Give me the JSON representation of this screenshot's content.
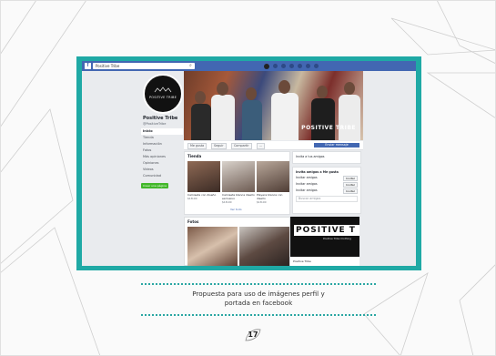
{
  "caption": {
    "line1": "Propuesta para uso de imágenes perfil y",
    "line2": "portada en facebook"
  },
  "page_number": "17",
  "facebook": {
    "logo": "f",
    "search_text": "Positive Tribe",
    "page_name": "Positive Tribe",
    "page_handle": "@PositiveTribe",
    "profile_logo_text": "POSITIVE TRIBE",
    "cover_caption": "POSITIVE TRIBE",
    "side_menu": [
      "Inicio",
      "Tienda",
      "Información",
      "Fotos",
      "Más opiniones",
      "Opiniones",
      "Videos",
      "Comunidad"
    ],
    "side_button": "Crear una página",
    "actions": [
      "Me gusta",
      "Seguir",
      "Compartir",
      "..."
    ],
    "send_button": "Enviar mensaje",
    "shop_title": "Tienda",
    "products": [
      {
        "caption": "Camiseta con diseño",
        "price": "$18.00"
      },
      {
        "caption": "Camiseta blanca diseño exclusivo",
        "price": "$18.00"
      },
      {
        "caption": "Playera blanca con diseño",
        "price": "$18.00"
      }
    ],
    "see_all": "Ver todo",
    "photos_title": "Fotos",
    "right_top": "Invita a tus amigos",
    "invite_title": "Invita amigos a Me gusta",
    "invite_rows": [
      "Invitar amigos",
      "Invitar amigos",
      "Invitar amigos"
    ],
    "invite_button": "Invitar",
    "invite_search": "Buscar amigos",
    "banner_text": "POSITIVE T",
    "banner_sub": "Positive Tribe Clothing",
    "banner_footer": "Positive Tribe"
  },
  "colors": {
    "frame_teal": "#1fa9a5",
    "facebook_blue": "#4267b2",
    "dotted_rule": "#2aa6a2"
  }
}
